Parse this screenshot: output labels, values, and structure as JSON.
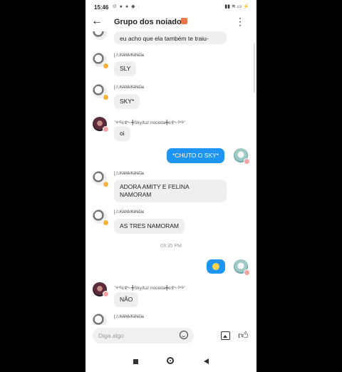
{
  "status_bar": {
    "time": "15:46",
    "notifications": "⊙ ● ● ◆ ·",
    "right": "▮▮ ≋ ▭ ⚡"
  },
  "header": {
    "back_icon": "arrow-left-icon",
    "title": "Grupo dos noiado",
    "menu_icon": "more-vertical-icon"
  },
  "messages": [
    {
      "sender": "",
      "text": "eu acho que ela também te traiu-"
    },
    {
      "sender": "[⚠K̶I̶W̶I̶/K̶I̶N̶G̶ɛ",
      "text": "SLY"
    },
    {
      "sender": "[⚠K̶I̶W̶I̶/K̶I̶N̶G̶ɛ",
      "text": "SKY*"
    },
    {
      "sender": "༺ɞ࿐╋Sky/luz noceda╋ɞ࿐༻",
      "text": "oi"
    },
    {
      "sender": "me",
      "text": "*CHUTO O SKY*"
    },
    {
      "sender": "[⚠K̶I̶W̶I̶/K̶I̶N̶G̶ɛ",
      "text": "ADORA AMITY E FELINA NAMORAM"
    },
    {
      "sender": "[⚠K̶I̶W̶I̶/K̶I̶N̶G̶ɛ",
      "text": "AS TRES NAMORAM"
    },
    {
      "sender": "me",
      "text": "emoji"
    },
    {
      "sender": "༺ɞ࿐╋Sky/luz noceda╋ɞ࿐༻",
      "text": "NÃO"
    },
    {
      "sender": "[⚠K̶I̶W̶I̶/K̶I̶N̶G̶ɛ",
      "text": ""
    }
  ],
  "time_separator": "03:35 PM",
  "composer": {
    "placeholder": "Diga algo",
    "emoji_icon": "emoji-icon",
    "image_icon": "image-icon",
    "like_icon": "thumbs-up-icon"
  },
  "nav": {
    "recents_icon": "square-icon",
    "home_icon": "home-circle-icon",
    "back_icon": "triangle-back-icon"
  }
}
